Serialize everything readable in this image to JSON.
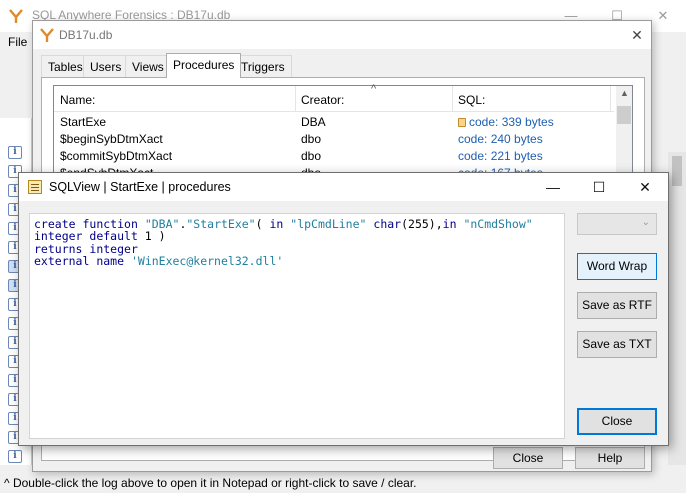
{
  "main_window": {
    "title": "SQL Anywhere Forensics : DB17u.db",
    "menu_file": "File",
    "minimize": "—",
    "maximize": "☐",
    "close": "✕",
    "log_icon_glyph": "i",
    "status_text": "^ Double-click the log above to open it in Notepad or right-click to save / clear."
  },
  "db_dialog": {
    "title": "DB17u.db",
    "close": "✕",
    "tabs": [
      {
        "label": "Tables"
      },
      {
        "label": "Users"
      },
      {
        "label": "Views"
      },
      {
        "label": "Procedures"
      },
      {
        "label": "Triggers"
      }
    ],
    "active_tab": "Procedures",
    "columns": {
      "name": "Name:",
      "creator": "Creator:",
      "sql": "SQL:"
    },
    "sort_indicator": "^",
    "rows": [
      {
        "name": "StartExe",
        "creator": "DBA",
        "sql": "code: 339 bytes",
        "locked": true
      },
      {
        "name": "$beginSybDtmXact",
        "creator": "dbo",
        "sql": "code: 240 bytes"
      },
      {
        "name": "$commitSybDtmXact",
        "creator": "dbo",
        "sql": "code: 221 bytes"
      },
      {
        "name": "$endSybDtmXact",
        "creator": "dbo",
        "sql": "code: 167 bytes"
      }
    ],
    "close_button": "Close",
    "help_button": "Help"
  },
  "sqlview": {
    "title": "SQLView | StartExe | procedures",
    "minimize": "—",
    "maximize": "☐",
    "close": "✕",
    "code_lines": [
      "create function \"DBA\".\"StartExe\"( in \"lpCmdLine\" char(255),in \"nCmdShow\"",
      "integer default 1 )",
      "returns integer",
      "external name 'WinExec@kernel32.dll'"
    ],
    "dropdown_value": "",
    "word_wrap_button": "Word Wrap",
    "save_rtf_button": "Save as RTF",
    "save_txt_button": "Save as TXT",
    "close_button": "Close"
  },
  "colors": {
    "accent": "#0078d7",
    "link": "#1f5fb0",
    "code_keyword": "#00008b",
    "code_string": "#1f7f9f"
  }
}
